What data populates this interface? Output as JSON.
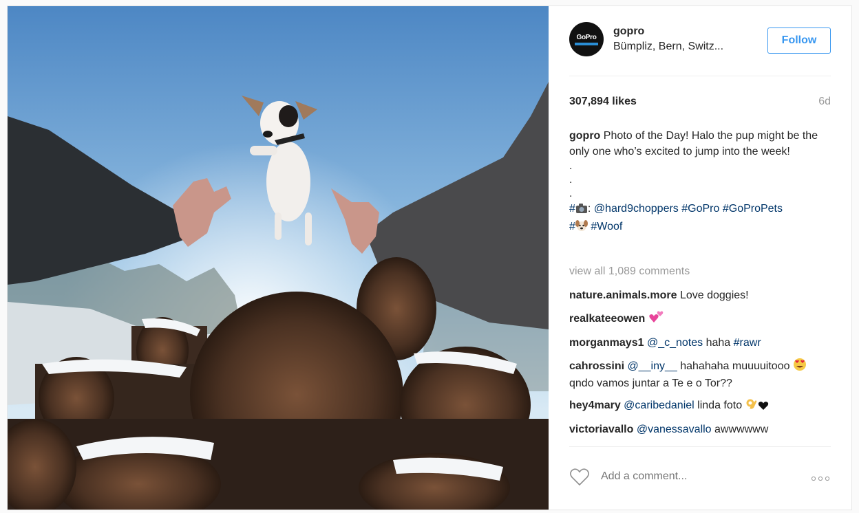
{
  "post": {
    "username": "gopro",
    "location": "Bümpliz, Bern, Switz...",
    "follow_label": "Follow",
    "likes": "307,894 likes",
    "time_ago": "6d",
    "avatar_logo": "GoPro"
  },
  "caption": {
    "user": "gopro",
    "text": "Photo of the Day! Halo the pup might be the only one who’s excited to jump into the week!",
    "dots": [
      ".",
      ".",
      "."
    ],
    "tag_prefix": "#",
    "camera_emoji_icon": "camera-emoji-icon",
    "tag_colon": ":",
    "mention": "@hard9choppers",
    "tag1": "#GoPro",
    "tag2": "#GoProPets",
    "tag3_prefix": "#",
    "dog_emoji_icon": "dog-emoji-icon",
    "tag4": "#Woof"
  },
  "view_all_comments": "view all 1,089 comments",
  "comments": [
    {
      "user": "nature.animals.more",
      "text": "Love doggies!"
    },
    {
      "user": "realkateeowen",
      "emoji": "two-hearts-emoji-icon"
    },
    {
      "user": "morganmays1",
      "mention": "@_c_notes",
      "text": "haha",
      "tag": "#rawr"
    },
    {
      "user": "cahrossini",
      "mention": "@__iny__",
      "text_before": "hahahaha muuuuitooo",
      "emoji": "heart-eyes-emoji-icon",
      "text_after": "qndo vamos juntar a Te e o Tor??"
    },
    {
      "user": "hey4mary",
      "mention": "@caribedaniel",
      "text": "linda foto",
      "emoji": "ok-hand-emoji-icon",
      "emoji2": "black-heart-icon"
    },
    {
      "user": "victoriavallo",
      "mention": "@vanessavallo",
      "text": "awwwwww"
    }
  ],
  "add_comment_placeholder": "Add a comment...",
  "icons": {
    "heart": "heart-outline-icon",
    "more": "more-options-icon"
  },
  "colors": {
    "link": "#003569",
    "follow_blue": "#3897f0",
    "muted": "#999999"
  }
}
